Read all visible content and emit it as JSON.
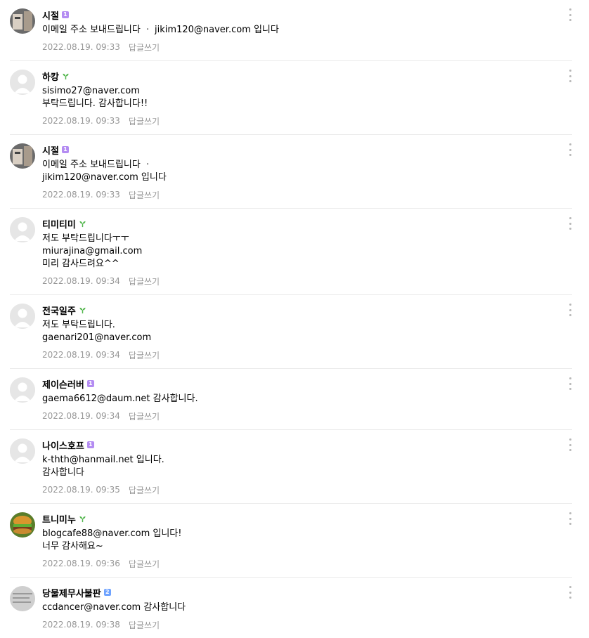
{
  "comments": [
    {
      "nick": "시절",
      "badge": "purple",
      "badge_text": "1",
      "avatar": "photo",
      "text": "이메일 주소 보내드립니다 ㆍ jikim120@naver.com 입니다",
      "date": "2022.08.19. 09:33",
      "reply": "답글쓰기"
    },
    {
      "nick": "하캉",
      "badge": "sprout",
      "badge_text": "",
      "avatar": "default",
      "text": "sisimo27@naver.com\n부탁드립니다. 감사합니다!!",
      "date": "2022.08.19. 09:33",
      "reply": "답글쓰기"
    },
    {
      "nick": "시절",
      "badge": "purple",
      "badge_text": "1",
      "avatar": "photo",
      "text": "이메일 주소 보내드립니다 ㆍ\njikim120@naver.com 입니다",
      "date": "2022.08.19. 09:33",
      "reply": "답글쓰기"
    },
    {
      "nick": "티미티미",
      "badge": "sprout",
      "badge_text": "",
      "avatar": "default",
      "text": "저도 부탁드립니다ㅜㅜ\nmiurajina@gmail.com\n미리 감사드려요^^",
      "date": "2022.08.19. 09:34",
      "reply": "답글쓰기"
    },
    {
      "nick": "전국일주",
      "badge": "sprout",
      "badge_text": "",
      "avatar": "default",
      "text": "저도 부탁드립니다.\ngaenari201@naver.com",
      "date": "2022.08.19. 09:34",
      "reply": "답글쓰기"
    },
    {
      "nick": "제이슨러버",
      "badge": "purple",
      "badge_text": "1",
      "avatar": "default",
      "text": "gaema6612@daum.net 감사합니다.",
      "date": "2022.08.19. 09:34",
      "reply": "답글쓰기"
    },
    {
      "nick": "나이스호프",
      "badge": "purple",
      "badge_text": "1",
      "avatar": "default",
      "text": "k-thth@hanmail.net 입니다.\n감사합니다",
      "date": "2022.08.19. 09:35",
      "reply": "답글쓰기"
    },
    {
      "nick": "트니미누",
      "badge": "sprout",
      "badge_text": "",
      "avatar": "burger",
      "text": "blogcafe88@naver.com 입니다!\n너무 감사해요~",
      "date": "2022.08.19. 09:36",
      "reply": "답글쓰기"
    },
    {
      "nick": "당물제무사불판",
      "badge": "blue",
      "badge_text": "2",
      "avatar": "paper",
      "text": "ccdancer@naver.com 감사합니다",
      "date": "2022.08.19. 09:38",
      "reply": "답글쓰기"
    }
  ],
  "colors": {
    "meta": "#979797",
    "sprout": "#52b64c",
    "badge_purple": "#b48cf2",
    "badge_blue": "#6fa3ff"
  },
  "icons": {
    "more": "more-vertical-icon",
    "sprout": "sprout-icon",
    "default_avatar": "default-avatar-icon"
  }
}
